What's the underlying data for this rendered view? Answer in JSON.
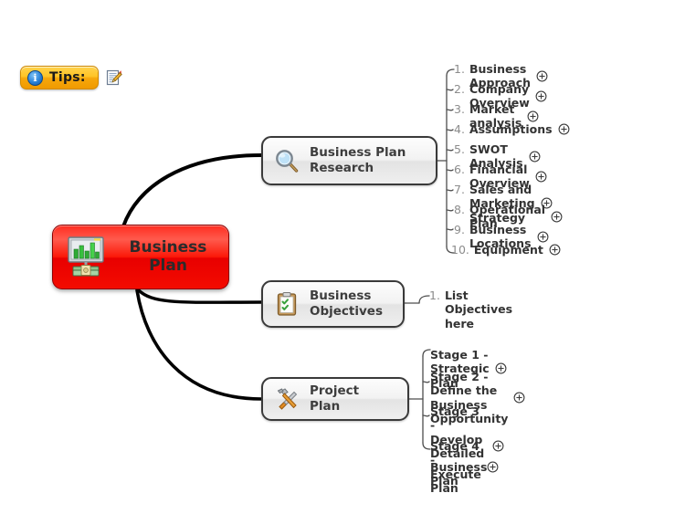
{
  "toolbar": {
    "tips_label": "Tips:",
    "info_icon": "info-icon",
    "note_icon": "note-edit-icon"
  },
  "mindmap": {
    "central": {
      "label": "Business\nPlan",
      "icon": "business-chart-money-icon",
      "color": "#ee0000"
    },
    "branches": [
      {
        "id": "business-plan-research",
        "label": "Business Plan\nResearch",
        "icon": "magnifier-icon",
        "children": [
          {
            "num": "1.",
            "label": "Business Approach",
            "expand": "plus-circle-icon"
          },
          {
            "num": "2.",
            "label": "Company Overview",
            "expand": "plus-circle-icon"
          },
          {
            "num": "3.",
            "label": "Market analysis",
            "expand": "plus-circle-icon"
          },
          {
            "num": "4.",
            "label": "Assumptions",
            "expand": "plus-circle-icon"
          },
          {
            "num": "5.",
            "label": "SWOT Analysis",
            "expand": "plus-circle-icon"
          },
          {
            "num": "6.",
            "label": "Financial Overview",
            "expand": "plus-circle-icon"
          },
          {
            "num": "7.",
            "label": "Sales and Marketing Strategy",
            "expand": "plus-circle-icon"
          },
          {
            "num": "8.",
            "label": "Operational Plan",
            "expand": "plus-circle-icon"
          },
          {
            "num": "9.",
            "label": "Business Locations",
            "expand": "plus-circle-icon"
          },
          {
            "num": "10.",
            "label": "Equipment",
            "expand": "plus-circle-icon"
          }
        ]
      },
      {
        "id": "business-objectives",
        "label": "Business\nObjectives",
        "icon": "clipboard-checklist-icon",
        "children": [
          {
            "num": "1.",
            "label": "List Objectives here",
            "expand": ""
          }
        ]
      },
      {
        "id": "project-plan",
        "label": "Project Plan",
        "icon": "hammer-wrench-icon",
        "children": [
          {
            "num": "",
            "label": "Stage 1 - Strategic Plan",
            "expand": "plus-circle-icon"
          },
          {
            "num": "",
            "label": "Stage 2 - Define the Business\nOpportunity",
            "expand": "plus-circle-icon"
          },
          {
            "num": "",
            "label": "Stage 3 - Develop Detailed\nBusiness Plan",
            "expand": "plus-circle-icon"
          },
          {
            "num": "",
            "label": "Stage 4 - Execute Plan",
            "expand": "plus-circle-icon"
          }
        ]
      }
    ]
  }
}
